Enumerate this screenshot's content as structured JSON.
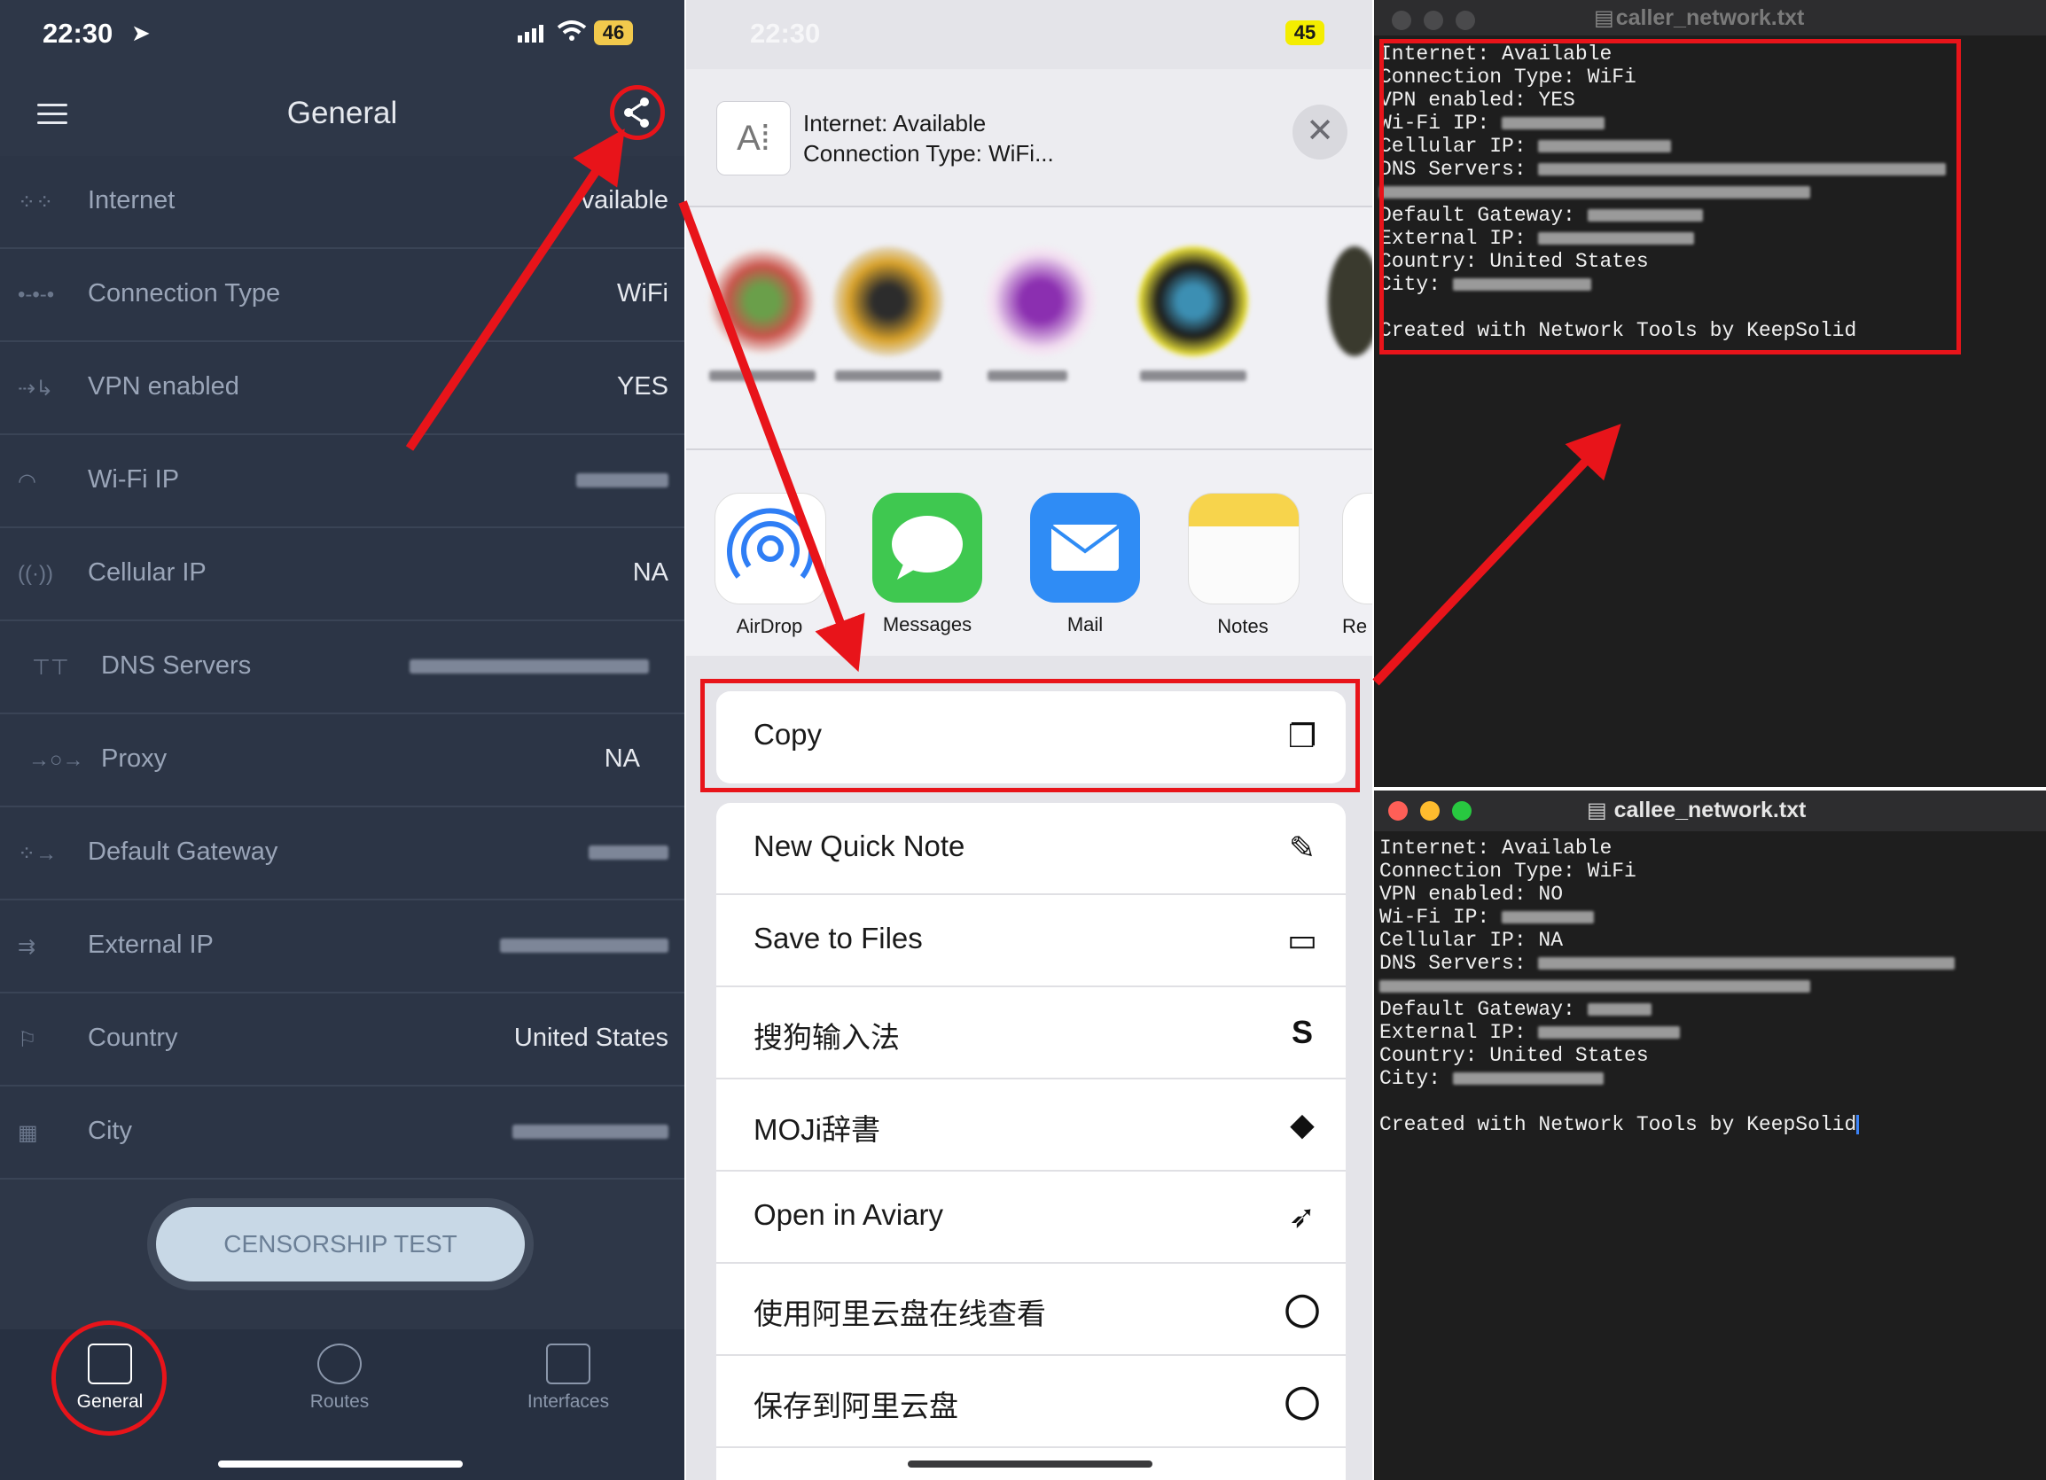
{
  "app_panel": {
    "status": {
      "time": "22:30",
      "battery": "46"
    },
    "header": {
      "title": "General"
    },
    "rows": [
      {
        "icon": "internet-icon",
        "label": "Internet",
        "value": "vailable"
      },
      {
        "icon": "connection-type-icon",
        "label": "Connection Type",
        "value": "WiFi"
      },
      {
        "icon": "vpn-icon",
        "label": "VPN enabled",
        "value": "YES"
      },
      {
        "icon": "wifi-icon",
        "label": "Wi-Fi IP",
        "value": ""
      },
      {
        "icon": "cellular-icon",
        "label": "Cellular IP",
        "value": "NA"
      },
      {
        "icon": "dns-icon",
        "label": "DNS Servers",
        "value": ""
      },
      {
        "icon": "proxy-icon",
        "label": "Proxy",
        "value": "NA"
      },
      {
        "icon": "gateway-icon",
        "label": "Default Gateway",
        "value": ""
      },
      {
        "icon": "external-ip-icon",
        "label": "External IP",
        "value": ""
      },
      {
        "icon": "flag-icon",
        "label": "Country",
        "value": "United States"
      },
      {
        "icon": "city-icon",
        "label": "City",
        "value": ""
      }
    ],
    "censorship_button": "CENSORSHIP TEST",
    "tabs": [
      {
        "label": "General",
        "icon": "home-icon",
        "active": true
      },
      {
        "label": "Routes",
        "icon": "routes-icon",
        "active": false
      },
      {
        "label": "Interfaces",
        "icon": "interfaces-icon",
        "active": false
      }
    ]
  },
  "share_sheet": {
    "status": {
      "time": "22:30",
      "battery": "45"
    },
    "preview": {
      "line1": "Internet: Available",
      "line2": "Connection Type: WiFi..."
    },
    "apps": [
      {
        "name": "AirDrop",
        "icon": "airdrop-icon",
        "color": "#2f7ef5"
      },
      {
        "name": "Messages",
        "icon": "messages-icon",
        "color": "#3fc850"
      },
      {
        "name": "Mail",
        "icon": "mail-icon",
        "color": "#2f8cf5"
      },
      {
        "name": "Notes",
        "icon": "notes-icon",
        "color": "#f7d44c"
      },
      {
        "name": "Re",
        "icon": "reminders-icon",
        "color": "#ffffff"
      }
    ],
    "copy": {
      "label": "Copy",
      "icon": "copy-icon"
    },
    "actions": [
      {
        "label": "New Quick Note",
        "icon": "quick-note-icon",
        "glyph": "✎"
      },
      {
        "label": "Save to Files",
        "icon": "folder-icon",
        "glyph": "▭"
      },
      {
        "label": "搜狗输入法",
        "icon": "sogou-icon",
        "glyph": "S"
      },
      {
        "label": "MOJi辞書",
        "icon": "moji-icon",
        "glyph": "◆"
      },
      {
        "label": "Open in Aviary",
        "icon": "aviary-icon",
        "glyph": "➶"
      },
      {
        "label": "使用阿里云盘在线查看",
        "icon": "aliyun-icon",
        "glyph": "◯"
      },
      {
        "label": "保存到阿里云盘",
        "icon": "aliyun-save-icon",
        "glyph": "◯"
      }
    ]
  },
  "caller_terminal": {
    "title": "caller_network.txt",
    "lines": [
      "Internet: Available",
      "Connection Type: WiFi",
      "VPN enabled: YES",
      "Wi-Fi IP:",
      "Cellular IP:",
      "DNS Servers:",
      "",
      "Default Gateway:",
      "External IP:",
      "Country: United States",
      "City:",
      "",
      "Created with Network Tools by KeepSolid"
    ]
  },
  "callee_terminal": {
    "title": "callee_network.txt",
    "lines": [
      "Internet: Available",
      "Connection Type: WiFi",
      "VPN enabled: NO",
      "Wi-Fi IP:",
      "Cellular IP: NA",
      "DNS Servers:",
      "",
      "Default Gateway:",
      "External IP:",
      "Country: United States",
      "City:",
      "",
      "Created with Network Tools by KeepSolid"
    ]
  },
  "colors": {
    "annotation_red": "#e8141a",
    "app_bg": "#2e3748",
    "terminal_bg": "#1e1e1e"
  }
}
